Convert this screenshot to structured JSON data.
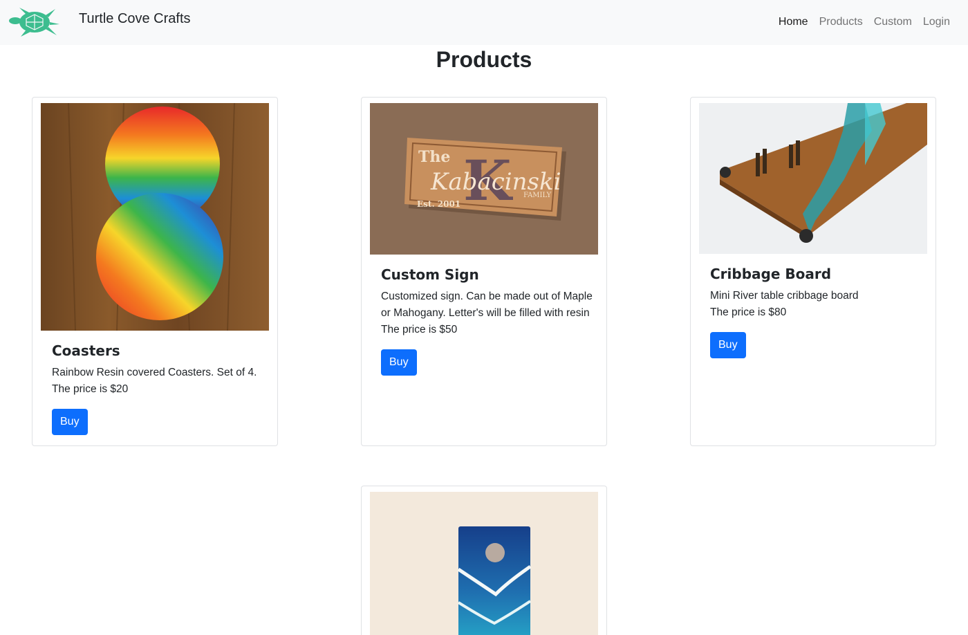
{
  "navbar": {
    "brand": "Turtle Cove Crafts",
    "links": [
      "Home",
      "Products",
      "Custom",
      "Login"
    ]
  },
  "page": {
    "title": "Products"
  },
  "products": [
    {
      "name": "Coasters",
      "description": "Rainbow Resin covered Coasters. Set of 4.",
      "price": "The price is $20",
      "button": "Buy"
    },
    {
      "name": "Custom Sign",
      "description": "Customized sign. Can be made out of Maple or Mahogany. Letter's will be filled with resin",
      "price": "The price is $50",
      "button": "Buy"
    },
    {
      "name": "Cribbage Board",
      "description": "Mini River table cribbage board",
      "price": "The price is $80",
      "button": "Buy"
    }
  ],
  "sign_image_text": {
    "line1": "The",
    "initial": "K",
    "name": "Kabacinski",
    "family": "FAMILY",
    "est": "Est. 2001"
  },
  "colors": {
    "primary": "#0d6efd",
    "navbar_bg": "#f8f9fa",
    "logo": "#3dbd8f"
  },
  "icons": [
    "turtle-logo-icon"
  ]
}
